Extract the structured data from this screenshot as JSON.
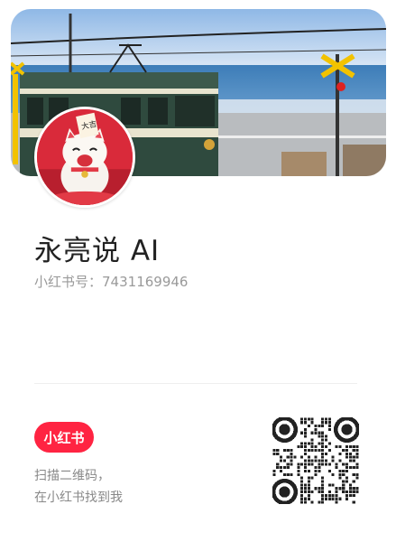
{
  "profile": {
    "name": "永亮说 AI",
    "id_label": "小红书号：",
    "id_value": "7431169946"
  },
  "footer": {
    "logo_text": "小红书",
    "hint_line1": "扫描二维码，",
    "hint_line2": "在小红书找到我"
  },
  "colors": {
    "brand": "#ff2442",
    "name_text": "#222222",
    "secondary_text": "#9a9a9a"
  },
  "icons": {
    "logo": "xiaohongshu-logo",
    "qr": "qr-code"
  }
}
